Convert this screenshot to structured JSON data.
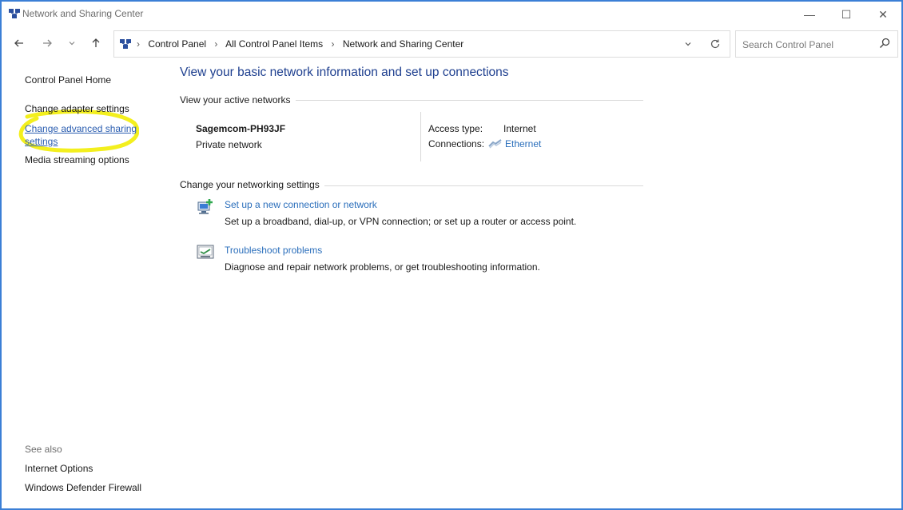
{
  "window": {
    "title": "Network and Sharing Center",
    "controls": {
      "minimize": "—",
      "maximize": "☐",
      "close": "✕"
    }
  },
  "nav": {
    "back_icon": "arrow-left-icon",
    "forward_icon": "arrow-right-icon",
    "recent_icon": "chevron-down-icon",
    "up_icon": "arrow-up-icon",
    "breadcrumbs": [
      "Control Panel",
      "All Control Panel Items",
      "Network and Sharing Center"
    ],
    "breadcrumb_separator": "›",
    "dropdown_glyph": "⌄",
    "refresh_glyph": "↻",
    "search_placeholder": "Search Control Panel"
  },
  "sidebar": {
    "home": "Control Panel Home",
    "items": [
      "Change adapter settings",
      "Change advanced sharing settings",
      "Media streaming options"
    ],
    "see_also_label": "See also",
    "see_also": [
      "Internet Options",
      "Windows Defender Firewall"
    ],
    "highlight_color": "#f3ef1e"
  },
  "main": {
    "heading": "View your basic network information and set up connections",
    "active_networks_title": "View your active networks",
    "network": {
      "name": "Sagemcom-PH93JF",
      "type": "Private network",
      "access_type_label": "Access type:",
      "access_type_value": "Internet",
      "connections_label": "Connections:",
      "connections_value": "Ethernet"
    },
    "settings_title": "Change your networking settings",
    "tasks": [
      {
        "icon": "new-connection-icon",
        "link": "Set up a new connection or network",
        "description": "Set up a broadband, dial-up, or VPN connection; or set up a router or access point."
      },
      {
        "icon": "troubleshoot-icon",
        "link": "Troubleshoot problems",
        "description": "Diagnose and repair network problems, or get troubleshooting information."
      }
    ]
  },
  "colors": {
    "link": "#2a6ebb",
    "heading": "#1e3f8f",
    "window_border": "#3b7fd6"
  }
}
